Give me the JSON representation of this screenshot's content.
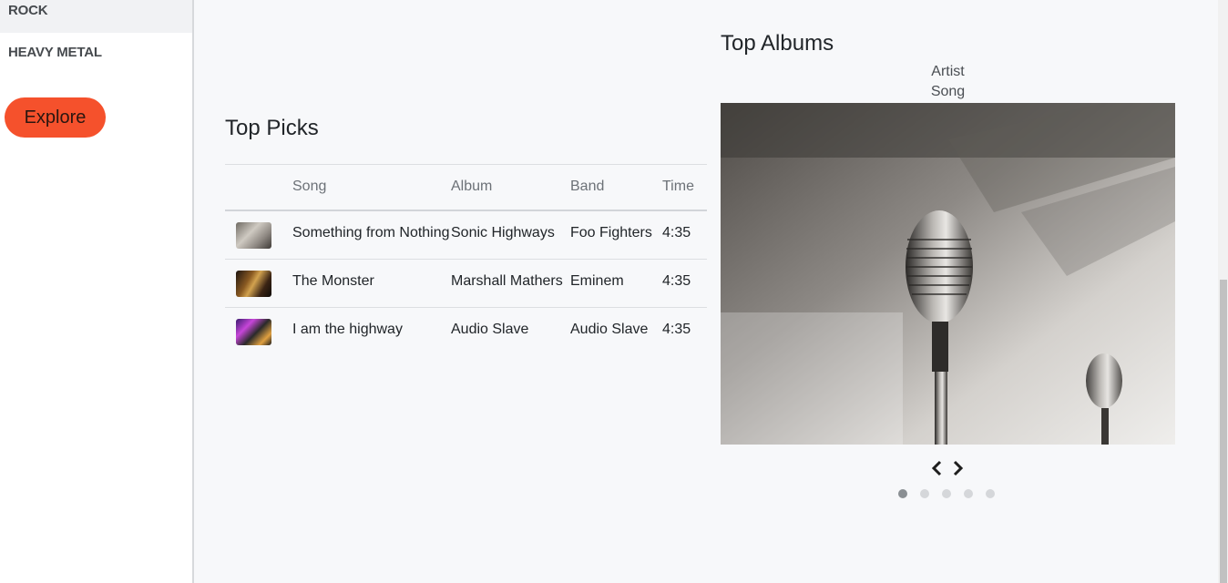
{
  "sidebar": {
    "genres": [
      "ROCK",
      "HEAVY METAL"
    ],
    "explore_label": "Explore"
  },
  "top_picks": {
    "title": "Top Picks",
    "headers": {
      "song": "Song",
      "album": "Album",
      "band": "Band",
      "time": "Time"
    },
    "rows": [
      {
        "song": "Something from Nothing",
        "album": "Sonic Highways",
        "band": "Foo Fighters",
        "time": "4:35"
      },
      {
        "song": "The Monster",
        "album": "Marshall Mathers",
        "band": "Eminem",
        "time": "4:35"
      },
      {
        "song": "I am the highway",
        "album": "Audio Slave",
        "band": "Audio Slave",
        "time": "4:35"
      }
    ]
  },
  "top_albums": {
    "title": "Top Albums",
    "caption": {
      "artist": "Artist",
      "song": "Song"
    },
    "slide_count": 5,
    "active_slide": 0
  },
  "colors": {
    "accent": "#f5512c",
    "background": "#f7f8fa",
    "sidebar_bg": "#ffffff"
  }
}
